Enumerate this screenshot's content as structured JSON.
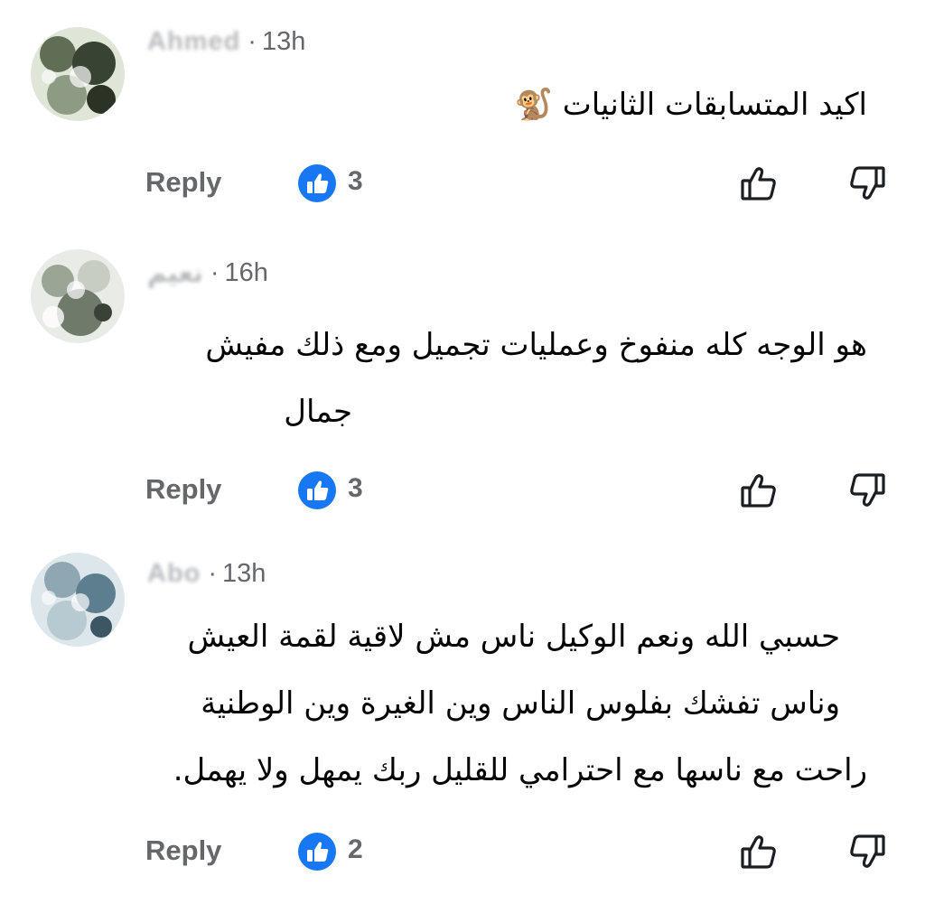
{
  "comments": [
    {
      "author": "Ahmed",
      "time": "13h",
      "lines": [
        "اكيد المتسابقات الثانيات 🐒"
      ],
      "reply_label": "Reply",
      "like_count": "3"
    },
    {
      "author": "نعيم",
      "time": "16h",
      "lines": [
        "هو الوجه كله منفوخ وعمليات تجميل ومع ذلك مفيش",
        "جمال"
      ],
      "reply_label": "Reply",
      "like_count": "3"
    },
    {
      "author": "Abo",
      "time": "13h",
      "lines": [
        "حسبي الله ونعم الوكيل ناس مش لاقية لقمة العيش",
        "وناس تفشك بفلوس الناس وين الغيرة وين الوطنية",
        "راحت مع ناسها مع احترامي للقليل ربك يمهل ولا يهمل."
      ],
      "reply_label": "Reply",
      "like_count": "2"
    }
  ],
  "separator": "·",
  "colors": {
    "like_badge": "#1877f2",
    "muted_text": "#65676b",
    "body_text": "#050505"
  },
  "icons": {
    "like_badge": "like-badge-icon",
    "thumb_up": "thumbs-up-icon",
    "thumb_down": "thumbs-down-icon"
  }
}
